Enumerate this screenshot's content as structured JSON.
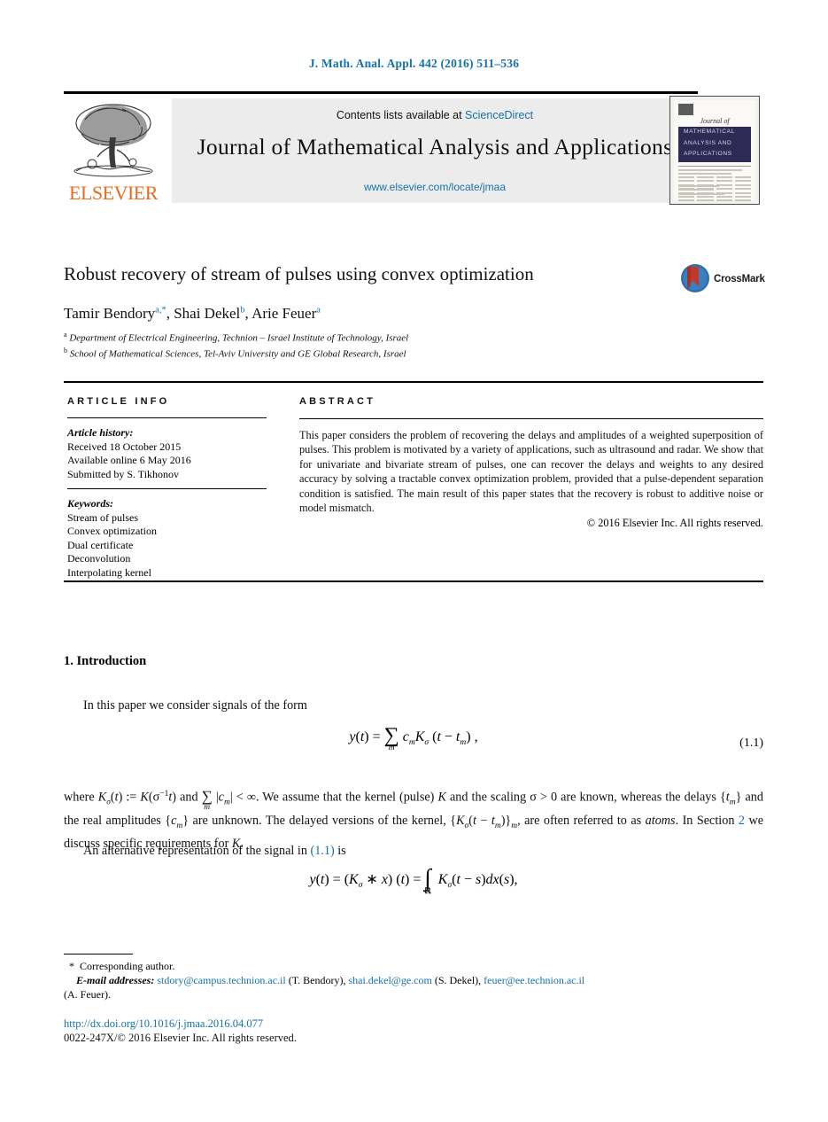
{
  "running_head": "J. Math. Anal. Appl. 442 (2016) 511–536",
  "masthead": {
    "contents_prefix": "Contents lists available at ",
    "sciencedirect": "ScienceDirect",
    "journal_title": "Journal of Mathematical Analysis and Applications",
    "journal_url": "www.elsevier.com/locate/jmaa",
    "publisher_wordmark": "ELSEVIER",
    "cover": {
      "journal_of": "Journal of",
      "band_line1": "MATHEMATICAL",
      "band_line2": "ANALYSIS AND",
      "band_line3": "APPLICATIONS"
    }
  },
  "article": {
    "title": "Robust recovery of stream of pulses using convex optimization",
    "authors_html": "Tamir Bendory<sup class=\"af\">a</sup><sup class=\"star\">,*</sup>, Shai Dekel<sup class=\"af\">b</sup>, Arie Feuer<sup class=\"af\">a</sup>",
    "affiliations": [
      {
        "marker": "a",
        "text": "Department of Electrical Engineering, Technion – Israel Institute of Technology, Israel"
      },
      {
        "marker": "b",
        "text": "School of Mathematical Sciences, Tel-Aviv University and GE Global Research, Israel"
      }
    ],
    "crossmark_label": "CrossMark"
  },
  "info": {
    "heading": "ARTICLE INFO",
    "history_label": "Article history:",
    "history": [
      "Received 18 October 2015",
      "Available online 6 May 2016",
      "Submitted by S. Tikhonov"
    ],
    "keywords_label": "Keywords:",
    "keywords": [
      "Stream of pulses",
      "Convex optimization",
      "Dual certificate",
      "Deconvolution",
      "Interpolating kernel"
    ]
  },
  "abstract": {
    "heading": "ABSTRACT",
    "text": "This paper considers the problem of recovering the delays and amplitudes of a weighted superposition of pulses. This problem is motivated by a variety of applications, such as ultrasound and radar. We show that for univariate and bivariate stream of pulses, one can recover the delays and weights to any desired accuracy by solving a tractable convex optimization problem, provided that a pulse-dependent separation condition is satisfied. The main result of this paper states that the recovery is robust to additive noise or model mismatch.",
    "copyright": "© 2016 Elsevier Inc. All rights reserved."
  },
  "body": {
    "section_heading": "1. Introduction",
    "paragraph_1": "In this paper we consider signals of the form",
    "equation_1_number": "(1.1)",
    "paragraph_2_segments": {
      "s1": "where ",
      "s2": " and ",
      "s3": ". We assume that the kernel (pulse) ",
      "s4": " and the scaling ",
      "s5": " are known, whereas the delays ",
      "s6": " and the real amplitudes ",
      "s7": " are unknown. The delayed versions of the kernel, ",
      "s8": ", are often referred to as ",
      "s9": "atoms",
      "s10": ". In Section ",
      "s11": "2",
      "s12": " we discuss specific requirements for ",
      "s13": "."
    },
    "paragraph_3_segments": {
      "s1": "An alternative representation of the signal in ",
      "s2": "(1.1)",
      "s3": " is"
    }
  },
  "footer": {
    "corresponding_marker": "*",
    "corresponding_text": "Corresponding author.",
    "email_label": "E-mail addresses:",
    "emails": [
      {
        "address": "stdory@campus.technion.ac.il",
        "person": "(T. Bendory)"
      },
      {
        "address": "shai.dekel@ge.com",
        "person": "(S. Dekel)"
      },
      {
        "address": "feuer@ee.technion.ac.il",
        "person": "(A. Feuer)."
      }
    ],
    "doi": "http://dx.doi.org/10.1016/j.jmaa.2016.04.077",
    "issn_line": "0022-247X/© 2016 Elsevier Inc. All rights reserved."
  },
  "colors": {
    "link": "#1672a8",
    "elsevier_orange": "#ea6a1e",
    "banner_gray": "#ececec",
    "cover_navy": "#2e2a55",
    "crossmark_red": "#c0392b",
    "crossmark_blue": "#2f6fae"
  }
}
